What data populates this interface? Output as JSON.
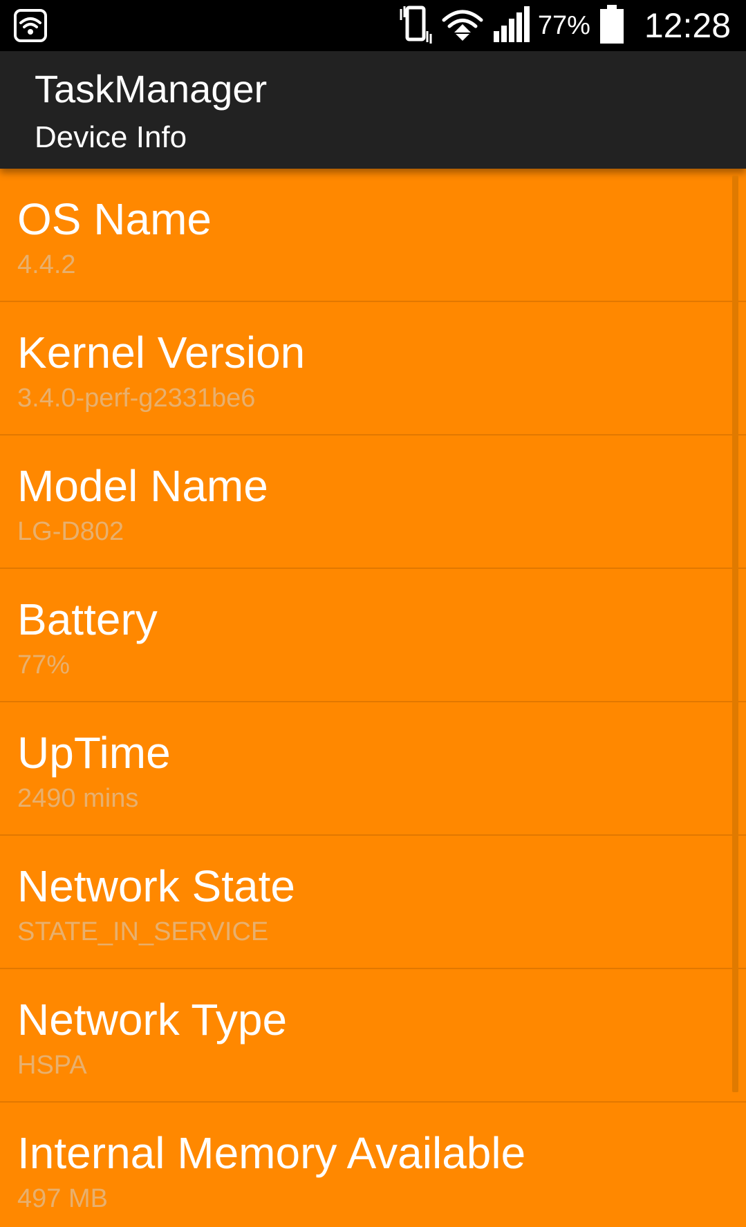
{
  "status_bar": {
    "battery_percent": "77%",
    "time": "12:28",
    "icons": [
      "wifi-hotspot-icon",
      "vibrate-icon",
      "wifi-icon",
      "signal-icon",
      "battery-icon"
    ]
  },
  "action_bar": {
    "title": "TaskManager",
    "subtitle": "Device Info"
  },
  "items": [
    {
      "title": "OS Name",
      "value": "4.4.2"
    },
    {
      "title": "Kernel Version",
      "value": "3.4.0-perf-g2331be6"
    },
    {
      "title": "Model Name",
      "value": "LG-D802"
    },
    {
      "title": "Battery",
      "value": "77%"
    },
    {
      "title": "UpTime",
      "value": "2490 mins"
    },
    {
      "title": "Network State",
      "value": "STATE_IN_SERVICE"
    },
    {
      "title": "Network Type",
      "value": "HSPA"
    },
    {
      "title": "Internal Memory Available",
      "value": "497 MB"
    }
  ],
  "colors": {
    "background": "#FF8800",
    "action_bar": "#222222",
    "status_bar": "#000000",
    "title_text": "#FFFFFF",
    "value_text": "#E8B06E"
  }
}
